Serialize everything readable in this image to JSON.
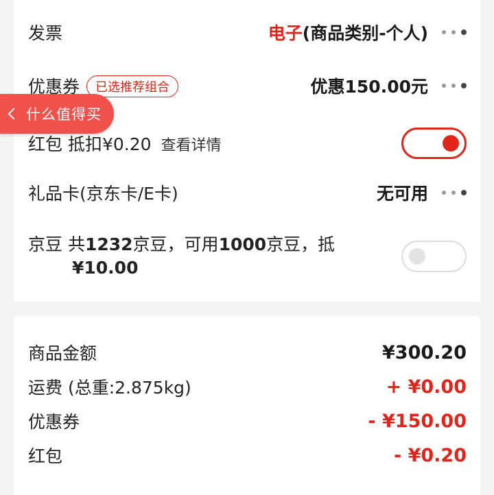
{
  "settings": {
    "invoice": {
      "label": "发票",
      "value_red": "电子",
      "value_rest": "(商品类别-个人)"
    },
    "coupon": {
      "label": "优惠券",
      "badge": "已选推荐组合",
      "value": "优惠150.00元"
    },
    "redpacket": {
      "label": "红包 抵扣¥0.20",
      "link": "查看详情",
      "enabled": true
    },
    "giftcard": {
      "label": "礼品卡(京东卡/E卡)",
      "value": "无可用"
    },
    "jingdou": {
      "line1_prefix": "京豆 共",
      "total": "1232",
      "line1_mid": "京豆，可用",
      "usable": "1000",
      "line1_suffix": "京豆，抵",
      "line2": "¥10.00",
      "enabled": false
    }
  },
  "floating_tag": {
    "label": "什么值得买"
  },
  "summary": {
    "rows": [
      {
        "label": "商品金额",
        "amount": "¥300.20",
        "color": "dark"
      },
      {
        "label": "运费 (总重:2.875kg)",
        "amount": "+ ¥0.00",
        "color": "red"
      },
      {
        "label": "优惠券",
        "amount": "- ¥150.00",
        "color": "red"
      },
      {
        "label": "红包",
        "amount": "- ¥0.20",
        "color": "red"
      }
    ]
  },
  "colors": {
    "accent": "#e1251b",
    "tag_bg": "#f0514a"
  }
}
